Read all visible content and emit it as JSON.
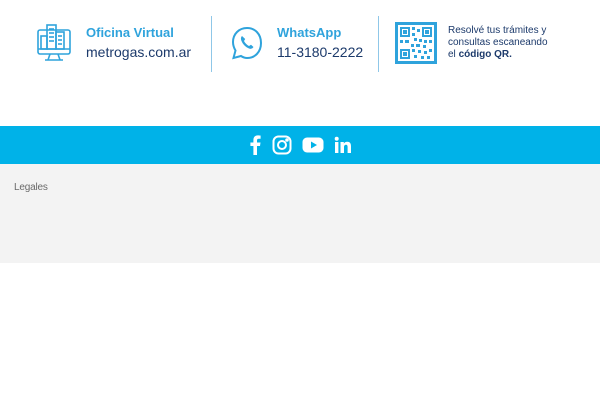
{
  "contact": {
    "oficina": {
      "heading": "Oficina Virtual",
      "value": "metrogas.com.ar",
      "icon": "monitor-building-icon"
    },
    "whatsapp": {
      "heading": "WhatsApp",
      "value": "11-3180-2222",
      "icon": "whatsapp-icon"
    },
    "qr": {
      "line1": "Resolvé tus trámites y",
      "line2": "consultas escaneando",
      "line3_prefix": "el ",
      "line3_bold": "código QR.",
      "icon": "qr-code-icon"
    }
  },
  "social": {
    "items": [
      {
        "name": "facebook",
        "icon": "facebook-icon"
      },
      {
        "name": "instagram",
        "icon": "instagram-icon"
      },
      {
        "name": "youtube",
        "icon": "youtube-icon"
      },
      {
        "name": "linkedin",
        "icon": "linkedin-icon"
      }
    ]
  },
  "footer": {
    "legal_label": "Legales"
  },
  "colors": {
    "accent": "#2fa3dc",
    "social_bar": "#00b2e8",
    "navy_text": "#1c3a6b",
    "legal_bg": "#f3f3f3"
  }
}
